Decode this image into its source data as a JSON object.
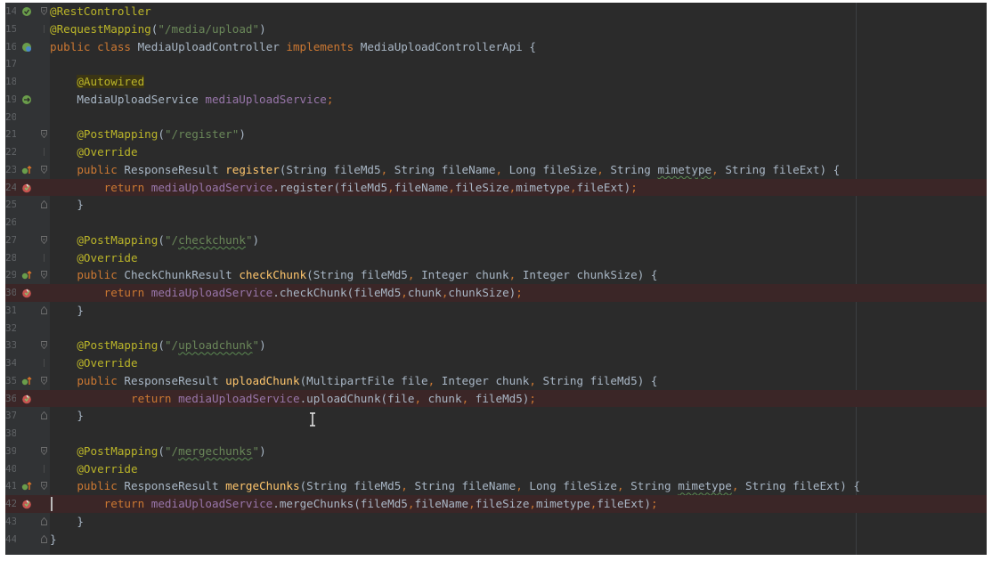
{
  "editor": {
    "lines": [
      {
        "n": "14",
        "icon": "bean",
        "fold": "open",
        "bp": false,
        "tokens": [
          [
            "an",
            "@RestController"
          ]
        ]
      },
      {
        "n": "15",
        "icon": "",
        "fold": "line",
        "bp": false,
        "tokens": [
          [
            "an",
            "@RequestMapping"
          ],
          [
            "pl",
            "("
          ],
          [
            "st",
            "\"/media/upload\""
          ],
          [
            "pl",
            ")"
          ]
        ]
      },
      {
        "n": "16",
        "icon": "bean-globe",
        "fold": "",
        "bp": false,
        "tokens": [
          [
            "kw",
            "public class "
          ],
          [
            "ty",
            "MediaUploadController "
          ],
          [
            "kw",
            "implements "
          ],
          [
            "ty",
            "MediaUploadControllerApi "
          ],
          [
            "pl",
            "{"
          ]
        ]
      },
      {
        "n": "17",
        "icon": "",
        "fold": "",
        "bp": false,
        "tokens": []
      },
      {
        "n": "18",
        "icon": "",
        "fold": "",
        "bp": false,
        "tokens": [
          [
            "pl",
            "    "
          ],
          [
            "an-hl",
            "@Autowired"
          ]
        ]
      },
      {
        "n": "19",
        "icon": "autowire",
        "fold": "",
        "bp": false,
        "tokens": [
          [
            "pl",
            "    MediaUploadService "
          ],
          [
            "fd",
            "mediaUploadService"
          ],
          [
            "kw",
            ";"
          ]
        ]
      },
      {
        "n": "20",
        "icon": "",
        "fold": "",
        "bp": false,
        "tokens": []
      },
      {
        "n": "21",
        "icon": "",
        "fold": "open",
        "bp": false,
        "tokens": [
          [
            "pl",
            "    "
          ],
          [
            "an",
            "@PostMapping"
          ],
          [
            "pl",
            "("
          ],
          [
            "st",
            "\"/register\""
          ],
          [
            "pl",
            ")"
          ]
        ]
      },
      {
        "n": "22",
        "icon": "",
        "fold": "line",
        "bp": false,
        "tokens": [
          [
            "pl",
            "    "
          ],
          [
            "an",
            "@Override"
          ]
        ]
      },
      {
        "n": "23",
        "icon": "impl",
        "fold": "open",
        "bp": false,
        "tokens": [
          [
            "pl",
            "    "
          ],
          [
            "kw",
            "public "
          ],
          [
            "pl",
            "ResponseResult "
          ],
          [
            "mt",
            "register"
          ],
          [
            "pl",
            "(String fileMd5"
          ],
          [
            "kw",
            ", "
          ],
          [
            "pl",
            "String fileName"
          ],
          [
            "kw",
            ", "
          ],
          [
            "pl",
            "Long fileSize"
          ],
          [
            "kw",
            ", "
          ],
          [
            "pl",
            "String "
          ],
          [
            "typo",
            "mimetype"
          ],
          [
            "kw",
            ", "
          ],
          [
            "pl",
            "String fileExt) {"
          ]
        ]
      },
      {
        "n": "24",
        "icon": "breakpoint",
        "fold": "",
        "bp": true,
        "tokens": [
          [
            "pl",
            "        "
          ],
          [
            "kw",
            "return "
          ],
          [
            "fd",
            "mediaUploadService"
          ],
          [
            "pl",
            ".register(fileMd5"
          ],
          [
            "kw",
            ","
          ],
          [
            "pl",
            "fileName"
          ],
          [
            "kw",
            ","
          ],
          [
            "pl",
            "fileSize"
          ],
          [
            "kw",
            ","
          ],
          [
            "pl",
            "mimetype"
          ],
          [
            "kw",
            ","
          ],
          [
            "pl",
            "fileExt)"
          ],
          [
            "kw",
            ";"
          ]
        ]
      },
      {
        "n": "25",
        "icon": "",
        "fold": "close",
        "bp": false,
        "tokens": [
          [
            "pl",
            "    }"
          ]
        ]
      },
      {
        "n": "26",
        "icon": "",
        "fold": "",
        "bp": false,
        "tokens": []
      },
      {
        "n": "27",
        "icon": "",
        "fold": "open",
        "bp": false,
        "tokens": [
          [
            "pl",
            "    "
          ],
          [
            "an",
            "@PostMapping"
          ],
          [
            "pl",
            "("
          ],
          [
            "st",
            "\"/"
          ],
          [
            "st typo",
            "checkchunk"
          ],
          [
            "st",
            "\""
          ],
          [
            "pl",
            ")"
          ]
        ]
      },
      {
        "n": "28",
        "icon": "",
        "fold": "line",
        "bp": false,
        "tokens": [
          [
            "pl",
            "    "
          ],
          [
            "an",
            "@Override"
          ]
        ]
      },
      {
        "n": "29",
        "icon": "impl",
        "fold": "open",
        "bp": false,
        "tokens": [
          [
            "pl",
            "    "
          ],
          [
            "kw",
            "public "
          ],
          [
            "pl",
            "CheckChunkResult "
          ],
          [
            "mt",
            "checkChunk"
          ],
          [
            "pl",
            "(String fileMd5"
          ],
          [
            "kw",
            ", "
          ],
          [
            "pl",
            "Integer chunk"
          ],
          [
            "kw",
            ", "
          ],
          [
            "pl",
            "Integer chunkSize) {"
          ]
        ]
      },
      {
        "n": "30",
        "icon": "breakpoint",
        "fold": "",
        "bp": true,
        "tokens": [
          [
            "pl",
            "        "
          ],
          [
            "kw",
            "return "
          ],
          [
            "fd",
            "mediaUploadService"
          ],
          [
            "pl",
            ".checkChunk(fileMd5"
          ],
          [
            "kw",
            ","
          ],
          [
            "pl",
            "chunk"
          ],
          [
            "kw",
            ","
          ],
          [
            "pl",
            "chunkSize)"
          ],
          [
            "kw",
            ";"
          ]
        ]
      },
      {
        "n": "31",
        "icon": "",
        "fold": "close",
        "bp": false,
        "tokens": [
          [
            "pl",
            "    }"
          ]
        ]
      },
      {
        "n": "32",
        "icon": "",
        "fold": "",
        "bp": false,
        "tokens": []
      },
      {
        "n": "33",
        "icon": "",
        "fold": "open",
        "bp": false,
        "tokens": [
          [
            "pl",
            "    "
          ],
          [
            "an",
            "@PostMapping"
          ],
          [
            "pl",
            "("
          ],
          [
            "st",
            "\"/"
          ],
          [
            "st typo",
            "uploadchunk"
          ],
          [
            "st",
            "\""
          ],
          [
            "pl",
            ")"
          ]
        ]
      },
      {
        "n": "34",
        "icon": "",
        "fold": "line",
        "bp": false,
        "tokens": [
          [
            "pl",
            "    "
          ],
          [
            "an",
            "@Override"
          ]
        ]
      },
      {
        "n": "35",
        "icon": "impl",
        "fold": "open",
        "bp": false,
        "tokens": [
          [
            "pl",
            "    "
          ],
          [
            "kw",
            "public "
          ],
          [
            "pl",
            "ResponseResult "
          ],
          [
            "mt",
            "uploadChunk"
          ],
          [
            "pl",
            "(MultipartFile file"
          ],
          [
            "kw",
            ", "
          ],
          [
            "pl",
            "Integer chunk"
          ],
          [
            "kw",
            ", "
          ],
          [
            "pl",
            "String fileMd5) {"
          ]
        ]
      },
      {
        "n": "36",
        "icon": "breakpoint",
        "fold": "",
        "bp": true,
        "tokens": [
          [
            "pl",
            "            "
          ],
          [
            "kw",
            "return "
          ],
          [
            "fd",
            "mediaUploadService"
          ],
          [
            "pl",
            ".uploadChunk(file"
          ],
          [
            "kw",
            ", "
          ],
          [
            "pl",
            "chunk"
          ],
          [
            "kw",
            ", "
          ],
          [
            "pl",
            "fileMd5)"
          ],
          [
            "kw",
            ";"
          ]
        ]
      },
      {
        "n": "37",
        "icon": "",
        "fold": "close",
        "bp": false,
        "tokens": [
          [
            "pl",
            "    }"
          ]
        ]
      },
      {
        "n": "38",
        "icon": "",
        "fold": "",
        "bp": false,
        "tokens": []
      },
      {
        "n": "39",
        "icon": "",
        "fold": "open",
        "bp": false,
        "tokens": [
          [
            "pl",
            "    "
          ],
          [
            "an",
            "@PostMapping"
          ],
          [
            "pl",
            "("
          ],
          [
            "st",
            "\"/"
          ],
          [
            "st typo",
            "mergechunks"
          ],
          [
            "st",
            "\""
          ],
          [
            "pl",
            ")"
          ]
        ]
      },
      {
        "n": "40",
        "icon": "",
        "fold": "line",
        "bp": false,
        "tokens": [
          [
            "pl",
            "    "
          ],
          [
            "an",
            "@Override"
          ]
        ]
      },
      {
        "n": "41",
        "icon": "impl",
        "fold": "open",
        "bp": false,
        "tokens": [
          [
            "pl",
            "    "
          ],
          [
            "kw",
            "public "
          ],
          [
            "pl",
            "ResponseResult "
          ],
          [
            "mt",
            "mergeChunks"
          ],
          [
            "pl",
            "(String fileMd5"
          ],
          [
            "kw",
            ", "
          ],
          [
            "pl",
            "String fileName"
          ],
          [
            "kw",
            ", "
          ],
          [
            "pl",
            "Long fileSize"
          ],
          [
            "kw",
            ", "
          ],
          [
            "pl",
            "String "
          ],
          [
            "typo",
            "mimetype"
          ],
          [
            "kw",
            ", "
          ],
          [
            "pl",
            "String fileExt) {"
          ]
        ]
      },
      {
        "n": "42",
        "icon": "breakpoint",
        "fold": "",
        "bp": true,
        "caret": true,
        "tokens": [
          [
            "pl",
            "        "
          ],
          [
            "kw",
            "return "
          ],
          [
            "fd",
            "mediaUploadService"
          ],
          [
            "pl",
            ".mergeChunks(fileMd5"
          ],
          [
            "kw",
            ","
          ],
          [
            "pl",
            "fileName"
          ],
          [
            "kw",
            ","
          ],
          [
            "pl",
            "fileSize"
          ],
          [
            "kw",
            ","
          ],
          [
            "pl",
            "mimetype"
          ],
          [
            "kw",
            ","
          ],
          [
            "pl",
            "fileExt)"
          ],
          [
            "kw",
            ";"
          ]
        ]
      },
      {
        "n": "43",
        "icon": "",
        "fold": "close",
        "bp": false,
        "tokens": [
          [
            "pl",
            "    }"
          ]
        ]
      },
      {
        "n": "44",
        "icon": "",
        "fold": "close",
        "bp": false,
        "tokens": [
          [
            "pl",
            "}"
          ]
        ]
      }
    ]
  },
  "colors": {
    "background": "#2b2b2b",
    "gutter": "#313335",
    "breakpoint_line": "#3b2627",
    "keyword": "#cc7832",
    "annotation": "#bbb529",
    "string": "#6a8759",
    "field": "#9876aa",
    "method": "#ffc66d"
  }
}
